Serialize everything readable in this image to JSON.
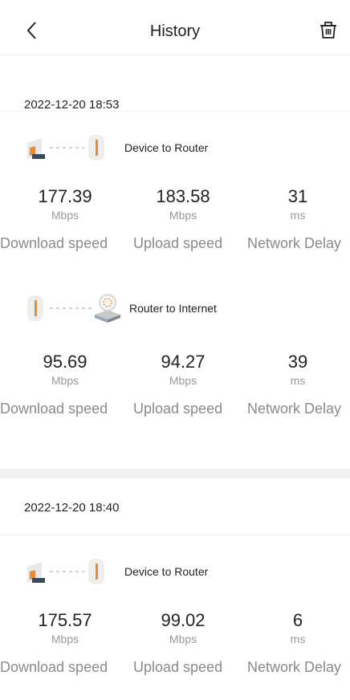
{
  "header": {
    "title": "History"
  },
  "records": [
    {
      "date": "2022-12-20 18:53",
      "tests": [
        {
          "label": "Device to Router",
          "download": {
            "value": "177.39",
            "unit": "Mbps"
          },
          "upload": {
            "value": "183.58",
            "unit": "Mbps"
          },
          "delay": {
            "value": "31",
            "unit": "ms"
          }
        },
        {
          "label": "Router to Internet",
          "download": {
            "value": "95.69",
            "unit": "Mbps"
          },
          "upload": {
            "value": "94.27",
            "unit": "Mbps"
          },
          "delay": {
            "value": "39",
            "unit": "ms"
          }
        }
      ]
    },
    {
      "date": "2022-12-20 18:40",
      "tests": [
        {
          "label": "Device to Router",
          "download": {
            "value": "175.57",
            "unit": "Mbps"
          },
          "upload": {
            "value": "99.02",
            "unit": "Mbps"
          },
          "delay": {
            "value": "6",
            "unit": "ms"
          }
        }
      ]
    }
  ],
  "labels": {
    "download": "Download speed",
    "upload": "Upload speed",
    "delay": "Network Delay"
  },
  "colors": {
    "accent": "#f08a24",
    "router": "#e6e6e6",
    "text": "#222222",
    "muted": "#8a8a8a"
  }
}
